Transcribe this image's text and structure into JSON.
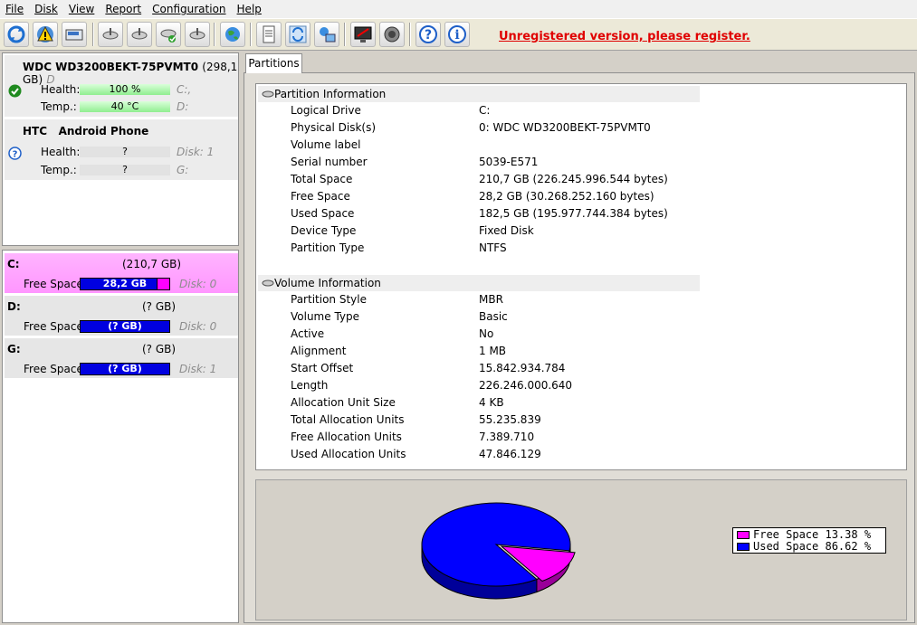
{
  "menu": [
    "File",
    "Disk",
    "View",
    "Report",
    "Configuration",
    "Help"
  ],
  "unregistered": "Unregistered version, please register.",
  "toolbar_icons": [
    "refresh-icon",
    "warning-icon",
    "drive-icon",
    "satellite-icon",
    "satellite-icon",
    "satellite-check-icon",
    "satellite-icon",
    "globe-icon",
    "report-icon",
    "sync-icon",
    "network-icon",
    "monitor-icon",
    "speaker-icon",
    "help-icon",
    "info-icon"
  ],
  "disks": [
    {
      "name": "WDC WD3200BEKT-75PVMT0",
      "capacity": "(298,1 GB)",
      "trail": "D",
      "status": "ok",
      "health_label": "Health:",
      "health": "100 %",
      "health_side": "C:,",
      "temp_label": "Temp.:",
      "temp": "40 °C",
      "temp_side": "D:"
    },
    {
      "name": "HTC",
      "model": "Android Phone",
      "status": "unknown",
      "health_label": "Health:",
      "health": "?",
      "health_side": "Disk: 1",
      "temp_label": "Temp.:",
      "temp": "?",
      "temp_side": "G:"
    }
  ],
  "partitions": [
    {
      "letter": "C:",
      "size": "(210,7 GB)",
      "free_label": "Free Space",
      "free": "28,2 GB",
      "free_fraction": 0.1338,
      "disk": "Disk: 0"
    },
    {
      "letter": "D:",
      "size": "(? GB)",
      "free_label": "Free Space",
      "free": "(? GB)",
      "free_fraction": 0,
      "disk": "Disk: 0"
    },
    {
      "letter": "G:",
      "size": "(? GB)",
      "free_label": "Free Space",
      "free": "(? GB)",
      "free_fraction": 0,
      "disk": "Disk: 1"
    }
  ],
  "tab": "Partitions",
  "partition_info": {
    "title": "Partition Information",
    "rows": [
      [
        "Logical Drive",
        "C:"
      ],
      [
        "Physical Disk(s)",
        "0: WDC WD3200BEKT-75PVMT0"
      ],
      [
        "Volume label",
        ""
      ],
      [
        "Serial number",
        "5039-E571"
      ],
      [
        "Total Space",
        "210,7 GB (226.245.996.544 bytes)"
      ],
      [
        "Free Space",
        "28,2 GB (30.268.252.160 bytes)"
      ],
      [
        "Used Space",
        "182,5 GB (195.977.744.384 bytes)"
      ],
      [
        "Device Type",
        "Fixed Disk"
      ],
      [
        "Partition Type",
        "NTFS"
      ]
    ]
  },
  "volume_info": {
    "title": "Volume Information",
    "rows": [
      [
        "Partition Style",
        "MBR"
      ],
      [
        "Volume Type",
        "Basic"
      ],
      [
        "Active",
        "No"
      ],
      [
        "Alignment",
        "1 MB"
      ],
      [
        "Start Offset",
        "15.842.934.784"
      ],
      [
        "Length",
        "226.246.000.640"
      ],
      [
        "Allocation Unit Size",
        "4 KB"
      ],
      [
        "Total Allocation Units",
        "55.235.839"
      ],
      [
        "Free Allocation Units",
        "7.389.710"
      ],
      [
        "Used Allocation Units",
        "47.846.129"
      ]
    ]
  },
  "chart_data": {
    "type": "pie",
    "series": [
      {
        "name": "Free Space",
        "value": 13.38,
        "color": "#ff00ff"
      },
      {
        "name": "Used Space",
        "value": 86.62,
        "color": "#0000ff"
      }
    ],
    "legend": [
      "Free Space 13.38 %",
      "Used Space 86.62 %"
    ]
  }
}
